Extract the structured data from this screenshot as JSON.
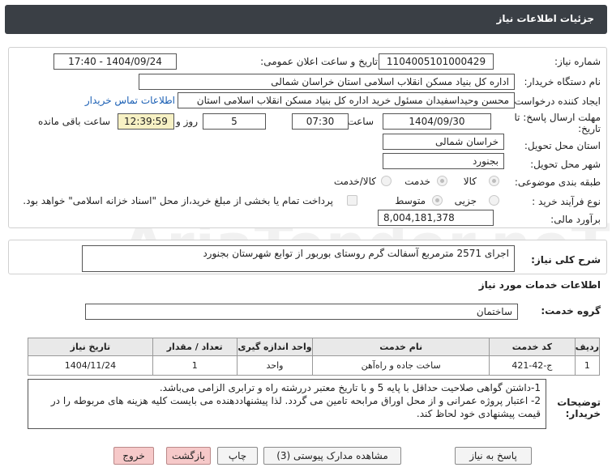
{
  "header": {
    "title": "جزئیات اطلاعات نیاز"
  },
  "form": {
    "need_number_label": "شماره نیاز:",
    "need_number": "1104005101000429",
    "announce_label": "تاریخ و ساعت اعلان عمومی:",
    "announce_value": "1404/09/24 - 17:40",
    "buyer_label": "نام دستگاه خریدار:",
    "buyer_value": "اداره کل بنیاد مسکن انقلاب اسلامی استان خراسان شمالی",
    "creator_label": "ایجاد کننده درخواست:",
    "creator_value": "محسن وحیداسفیدان مسئول خرید اداره کل بنیاد مسکن انقلاب اسلامی استان",
    "contact_link": "اطلاعات تماس خریدار",
    "deadline_label_1": "مهلت ارسال پاسخ: تا",
    "deadline_label_2": "تاریخ:",
    "deadline_date": "1404/09/30",
    "time_label": "ساعت",
    "deadline_time": "07:30",
    "days_value": "5",
    "days_label": "روز و",
    "remaining_time": "12:39:59",
    "remaining_label": "ساعت باقی مانده",
    "province_label": "استان محل تحویل:",
    "province_value": "خراسان شمالی",
    "city_label": "شهر محل تحویل:",
    "city_value": "بجنورد",
    "category_label": "طبقه بندی موضوعی:",
    "category_options": [
      "کالا",
      "خدمت",
      "کالا/خدمت"
    ],
    "process_label": "نوع فرآیند خرید :",
    "process_options": [
      "جزیی",
      "متوسط"
    ],
    "payment_note": "پرداخت تمام یا بخشی از مبلغ خرید،از محل \"اسناد خزانه اسلامی\" خواهد بود.",
    "budget_label": "برآورد مالی:",
    "budget_value": "8,004,181,378"
  },
  "summary": {
    "label": "شرح کلی نیاز:",
    "value": "اجرای 2571 مترمربع آسفالت گرم روستای بوربور از توابع شهرستان بجنورد"
  },
  "services": {
    "section_title": "اطلاعات خدمات مورد نیاز",
    "group_label": "گروه خدمت:",
    "group_value": "ساختمان",
    "columns": [
      "ردیف",
      "کد خدمت",
      "نام خدمت",
      "واحد اندازه گیری",
      "تعداد / مقدار",
      "تاریخ نیاز"
    ],
    "rows": [
      {
        "index": "1",
        "code": "ج-42-421",
        "name": "ساخت جاده و راه‌آهن",
        "unit": "واحد",
        "qty": "1",
        "date": "1404/11/24"
      }
    ]
  },
  "notes": {
    "label_1": "توضیحات",
    "label_2": "خریدار:",
    "line_1": "1-داشتن گواهی صلاحیت حداقل با پایه 5 و با تاریخ معتبر دررشته راه و ترابری الزامی می‌باشد.",
    "line_2": "2- اعتبار پروژه عمرانی و از محل اوراق مرابحه تامین می گردد. لذا پیشنهاددهنده می بایست کلیه هزینه های مربوطه را در",
    "line_3": "قیمت پیشنهادی خود لحاظ کند."
  },
  "buttons": {
    "reply": "پاسخ به نیاز",
    "documents": "مشاهده مدارک پیوستی (3)",
    "print": "چاپ",
    "back": "بازگشت",
    "exit": "خروج"
  },
  "watermark": "AriaTender.neT"
}
